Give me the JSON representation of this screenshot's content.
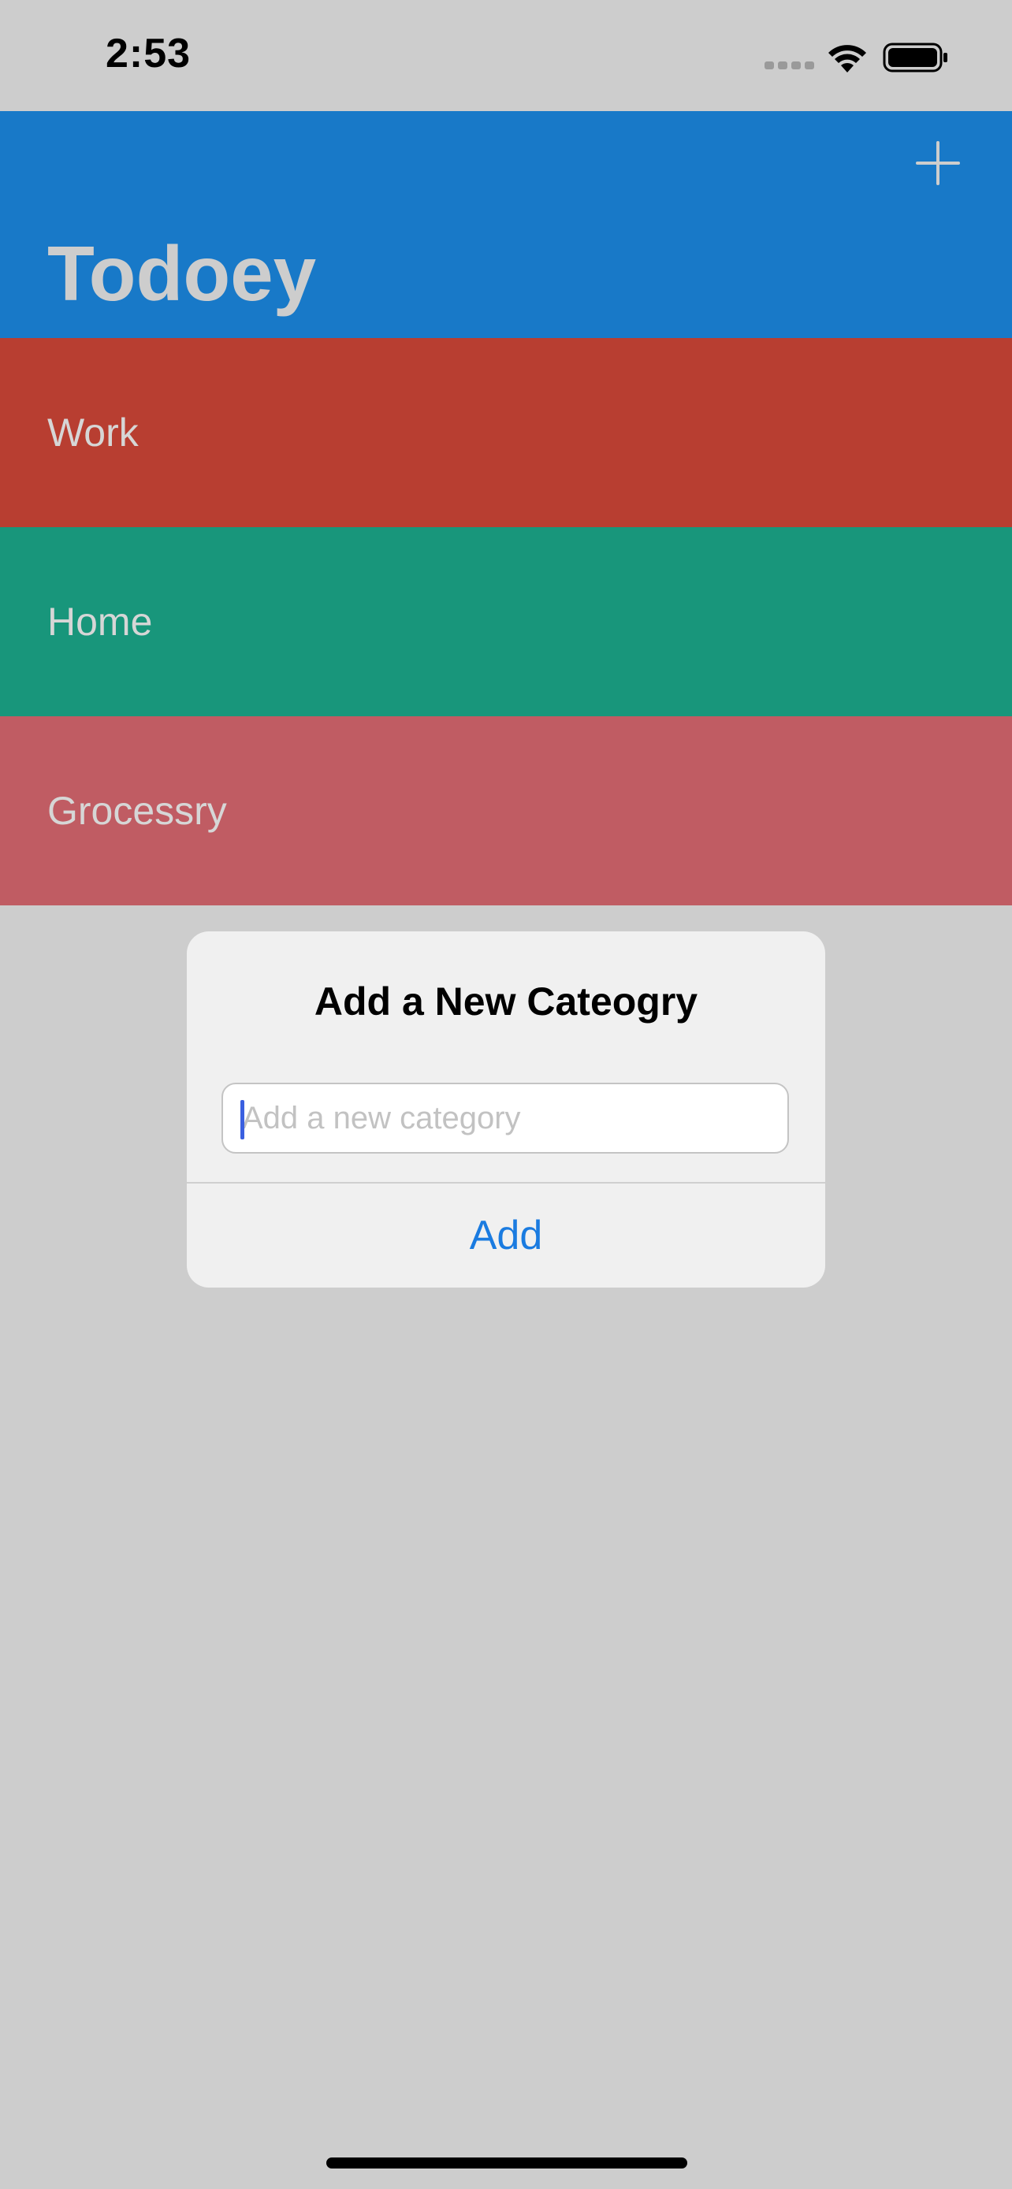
{
  "status_bar": {
    "time": "2:53",
    "icons": [
      "cellular-signal-icon",
      "wifi-icon",
      "battery-icon"
    ]
  },
  "navbar": {
    "title": "Todoey",
    "add_icon": "plus-icon",
    "background": "#1879c8"
  },
  "categories": [
    {
      "label": "Work",
      "color": "#b83e31"
    },
    {
      "label": "Home",
      "color": "#18967b"
    },
    {
      "label": "Grocessry",
      "color": "#c05c63"
    }
  ],
  "alert": {
    "title": "Add a New Cateogry",
    "input": {
      "value": "",
      "placeholder": "Add a new category"
    },
    "action_label": "Add",
    "action_color": "#1a7be0"
  },
  "colors": {
    "background": "#cdcdcd",
    "alert_background": "#f0f0f0"
  }
}
